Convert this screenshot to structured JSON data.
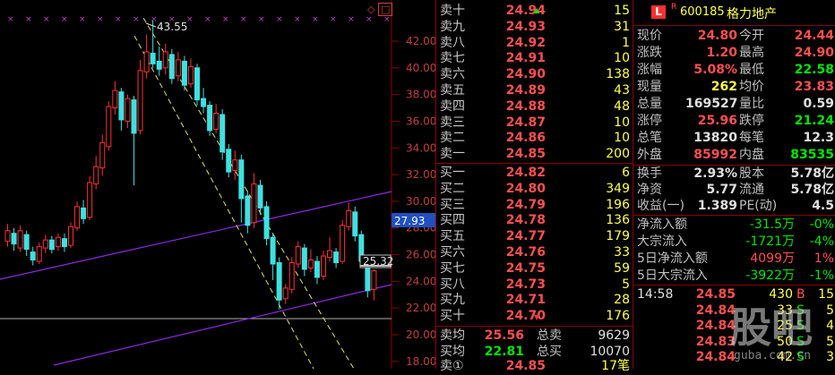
{
  "chart": {
    "high_label": "43.55",
    "right_price_tag": "27.93",
    "last_price_tag": "25.32",
    "y_ticks": [
      "42.00",
      "40.00",
      "38.00",
      "36.00",
      "34.00",
      "32.00",
      "30.00",
      "28.00",
      "26.00",
      "24.00",
      "22.00",
      "20.00",
      "18.00"
    ]
  },
  "order_book": {
    "asks": [
      {
        "label": "卖十",
        "price": "24.94",
        "vol": "15"
      },
      {
        "label": "卖九",
        "price": "24.93",
        "vol": "31"
      },
      {
        "label": "卖八",
        "price": "24.92",
        "vol": "1"
      },
      {
        "label": "卖七",
        "price": "24.91",
        "vol": "10"
      },
      {
        "label": "卖六",
        "price": "24.90",
        "vol": "138"
      },
      {
        "label": "卖五",
        "price": "24.89",
        "vol": "43"
      },
      {
        "label": "卖四",
        "price": "24.88",
        "vol": "48"
      },
      {
        "label": "卖三",
        "price": "24.87",
        "vol": "10"
      },
      {
        "label": "卖二",
        "price": "24.86",
        "vol": "10"
      },
      {
        "label": "卖一",
        "price": "24.85",
        "vol": "200"
      }
    ],
    "bids": [
      {
        "label": "买一",
        "price": "24.82",
        "vol": "6"
      },
      {
        "label": "买二",
        "price": "24.80",
        "vol": "349"
      },
      {
        "label": "买三",
        "price": "24.79",
        "vol": "196"
      },
      {
        "label": "买四",
        "price": "24.78",
        "vol": "136"
      },
      {
        "label": "买五",
        "price": "24.77",
        "vol": "179"
      },
      {
        "label": "买六",
        "price": "24.76",
        "vol": "33"
      },
      {
        "label": "买七",
        "price": "24.75",
        "vol": "59"
      },
      {
        "label": "买八",
        "price": "24.73",
        "vol": "5"
      },
      {
        "label": "买九",
        "price": "24.71",
        "vol": "28"
      },
      {
        "label": "买十",
        "price": "24.70",
        "vol": "176"
      }
    ],
    "summary": [
      {
        "k1": "卖均",
        "v1": "25.56",
        "k2": "总卖",
        "v2": "9629"
      },
      {
        "k1": "买均",
        "v1": "22.81",
        "k2": "总买",
        "v2": "10070"
      }
    ],
    "last_row": {
      "label": "卖①",
      "price": "24.85",
      "vol": "17笔"
    }
  },
  "stock": {
    "badge": "L",
    "superscript": "R",
    "code": "600185",
    "name": "格力地产"
  },
  "quote": [
    {
      "k1": "现价",
      "v1": "24.80",
      "k2": "今开",
      "v2": "24.44"
    },
    {
      "k1": "涨跌",
      "v1": "1.20",
      "k2": "最高",
      "v2": "24.90"
    },
    {
      "k1": "涨幅",
      "v1": "5.08%",
      "k2": "最低",
      "v2": "22.58"
    },
    {
      "k1": "现量",
      "v1": "262",
      "k2": "均价",
      "v2": "23.83"
    },
    {
      "k1": "总量",
      "v1": "169527",
      "k2": "量比",
      "v2": "0.59"
    },
    {
      "k1": "涨停",
      "v1": "25.96",
      "k2": "跌停",
      "v2": "21.24"
    },
    {
      "k1": "总笔",
      "v1": "13820",
      "k2": "每笔",
      "v2": "12.3"
    },
    {
      "k1": "外盘",
      "v1": "85992",
      "k2": "内盘",
      "v2": "83535"
    }
  ],
  "fund": [
    {
      "k1": "换手",
      "v1": "2.93%",
      "k2": "股本",
      "v2": "5.78亿"
    },
    {
      "k1": "净资",
      "v1": "5.77",
      "k2": "流通",
      "v2": "5.78亿"
    },
    {
      "k1": "收益(一)",
      "v1": "1.389",
      "k2": "PE(动)",
      "v2": "4.5"
    }
  ],
  "flows": [
    {
      "label": "净流入额",
      "value": "-31.5万",
      "pct": "-0%"
    },
    {
      "label": "大宗流入",
      "value": "-1721万",
      "pct": "-4%"
    },
    {
      "label": "5日净流入额",
      "value": "4099万",
      "pct": "1%"
    },
    {
      "label": "5日大宗流入",
      "value": "-3922万",
      "pct": "-1%"
    }
  ],
  "ticks": [
    {
      "time": "14:58",
      "price": "24.85",
      "vol": "430",
      "side": "B",
      "n": "15"
    },
    {
      "time": "",
      "price": "24.84",
      "vol": "33",
      "side": "S",
      "n": "5"
    },
    {
      "time": "",
      "price": "24.84",
      "vol": "25",
      "side": "S",
      "n": "4"
    },
    {
      "time": "",
      "price": "24.83",
      "vol": "50",
      "side": "S",
      "n": "5"
    },
    {
      "time": "",
      "price": "24.84",
      "vol": "42",
      "side": "S",
      "n": "3"
    }
  ],
  "watermark": {
    "big": "股吧",
    "small": "guba.com.cn"
  }
}
